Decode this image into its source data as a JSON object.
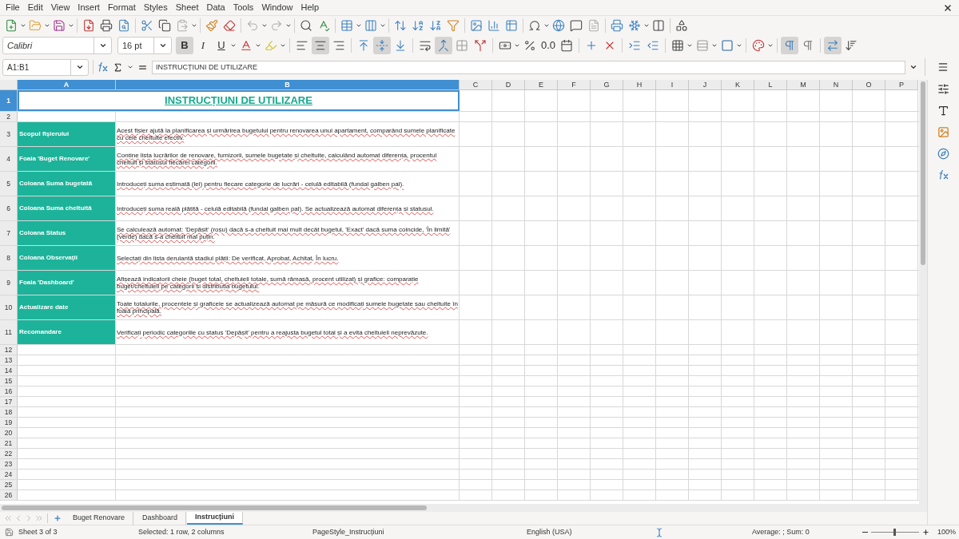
{
  "menu": [
    "File",
    "Edit",
    "View",
    "Insert",
    "Format",
    "Styles",
    "Sheet",
    "Data",
    "Tools",
    "Window",
    "Help"
  ],
  "standard_toolbar": [
    {
      "kind": "new",
      "dropdown": true,
      "disabled": false
    },
    {
      "kind": "open",
      "dropdown": true,
      "disabled": false
    },
    {
      "kind": "save",
      "dropdown": true,
      "disabled": false
    },
    {
      "kind": "sep"
    },
    {
      "kind": "pdf",
      "disabled": false
    },
    {
      "kind": "print",
      "disabled": false
    },
    {
      "kind": "preview",
      "disabled": false
    },
    {
      "kind": "sep"
    },
    {
      "kind": "cut",
      "disabled": false
    },
    {
      "kind": "copy",
      "disabled": false
    },
    {
      "kind": "paste",
      "dropdown": true,
      "disabled": true
    },
    {
      "kind": "sep"
    },
    {
      "kind": "clone",
      "disabled": false
    },
    {
      "kind": "clear",
      "disabled": false
    },
    {
      "kind": "sep"
    },
    {
      "kind": "undo",
      "dropdown": true,
      "disabled": true
    },
    {
      "kind": "redo",
      "dropdown": true,
      "disabled": true
    },
    {
      "kind": "sep"
    },
    {
      "kind": "find",
      "disabled": false
    },
    {
      "kind": "spelling",
      "disabled": false
    },
    {
      "kind": "sep"
    },
    {
      "kind": "rows",
      "dropdown": true,
      "disabled": false
    },
    {
      "kind": "columns",
      "dropdown": true,
      "disabled": false
    },
    {
      "kind": "sep"
    },
    {
      "kind": "sort",
      "disabled": false
    },
    {
      "kind": "sort-asc",
      "disabled": false
    },
    {
      "kind": "sort-desc",
      "disabled": false
    },
    {
      "kind": "filter",
      "disabled": false
    },
    {
      "kind": "sep"
    },
    {
      "kind": "image",
      "disabled": false
    },
    {
      "kind": "chart",
      "disabled": false
    },
    {
      "kind": "pivot",
      "disabled": false
    },
    {
      "kind": "sep"
    },
    {
      "kind": "special-char",
      "dropdown": true,
      "disabled": false
    },
    {
      "kind": "link",
      "disabled": false
    },
    {
      "kind": "comment",
      "disabled": false
    },
    {
      "kind": "header-footer",
      "disabled": true
    },
    {
      "kind": "sep"
    },
    {
      "kind": "print-range",
      "disabled": false
    },
    {
      "kind": "freeze",
      "dropdown": true,
      "disabled": false
    },
    {
      "kind": "split",
      "disabled": false
    },
    {
      "kind": "sep"
    },
    {
      "kind": "shapes",
      "disabled": false
    }
  ],
  "font_name": "Calibri",
  "font_size": "16 pt",
  "format_toolbar": [
    {
      "kind": "bold",
      "label": "B",
      "pressed": true
    },
    {
      "kind": "italic",
      "label": "I",
      "pressed": false
    },
    {
      "kind": "underline",
      "label": "U",
      "dropdown": true,
      "pressed": false
    },
    {
      "kind": "font-color",
      "dropdown": true,
      "pressed": false
    },
    {
      "kind": "highlight",
      "dropdown": true,
      "pressed": false
    },
    {
      "kind": "sep"
    },
    {
      "kind": "align-left",
      "pressed": false
    },
    {
      "kind": "align-center",
      "pressed": true
    },
    {
      "kind": "align-right",
      "pressed": false
    },
    {
      "kind": "sep"
    },
    {
      "kind": "align-top",
      "pressed": false
    },
    {
      "kind": "align-middle",
      "pressed": true
    },
    {
      "kind": "align-bottom",
      "pressed": false
    },
    {
      "kind": "sep"
    },
    {
      "kind": "wrap",
      "pressed": false
    },
    {
      "kind": "merge-center",
      "pressed": true
    },
    {
      "kind": "merge",
      "pressed": false
    },
    {
      "kind": "unmerge",
      "pressed": false
    },
    {
      "kind": "sep"
    },
    {
      "kind": "currency",
      "dropdown": true,
      "pressed": false
    },
    {
      "kind": "percent",
      "pressed": false
    },
    {
      "kind": "number",
      "label": "0.0",
      "pressed": false
    },
    {
      "kind": "date",
      "pressed": false
    },
    {
      "kind": "sep"
    },
    {
      "kind": "add-decimal",
      "pressed": false
    },
    {
      "kind": "delete-decimal",
      "pressed": false
    },
    {
      "kind": "sep"
    },
    {
      "kind": "indent",
      "pressed": false
    },
    {
      "kind": "outdent",
      "pressed": false
    },
    {
      "kind": "sep"
    },
    {
      "kind": "borders",
      "dropdown": true,
      "pressed": false
    },
    {
      "kind": "border-style",
      "dropdown": true,
      "pressed": false
    },
    {
      "kind": "border-color",
      "dropdown": true,
      "pressed": false
    },
    {
      "kind": "sep"
    },
    {
      "kind": "conditional",
      "dropdown": true,
      "pressed": false
    },
    {
      "kind": "sep"
    },
    {
      "kind": "ltr",
      "pressed": true
    },
    {
      "kind": "rtl",
      "pressed": false
    },
    {
      "kind": "sep"
    },
    {
      "kind": "text-horizontal",
      "pressed": true
    },
    {
      "kind": "text-vertical",
      "pressed": false
    }
  ],
  "name_box": "A1:B1",
  "formula": "INSTRUCȚIUNI DE UTILIZARE",
  "columns": [
    {
      "label": "A",
      "selected": true
    },
    {
      "label": "B",
      "selected": true
    },
    {
      "label": "C",
      "selected": false
    },
    {
      "label": "D",
      "selected": false
    },
    {
      "label": "E",
      "selected": false
    },
    {
      "label": "F",
      "selected": false
    },
    {
      "label": "G",
      "selected": false
    },
    {
      "label": "H",
      "selected": false
    },
    {
      "label": "I",
      "selected": false
    },
    {
      "label": "J",
      "selected": false
    },
    {
      "label": "K",
      "selected": false
    },
    {
      "label": "L",
      "selected": false
    },
    {
      "label": "M",
      "selected": false
    },
    {
      "label": "N",
      "selected": false
    },
    {
      "label": "O",
      "selected": false
    },
    {
      "label": "P",
      "selected": false
    }
  ],
  "rows": [
    {
      "number": "1",
      "kind": "title",
      "selected": true,
      "title": "INSTRUCȚIUNI DE UTILIZARE"
    },
    {
      "number": "2",
      "kind": "spacer",
      "selected": false
    },
    {
      "number": "3",
      "kind": "entry",
      "selected": false,
      "a": "Scopul fișierului",
      "b": "Acest fișier ajută la planificarea și urmărirea bugetului pentru renovarea unui apartament, comparând sumele planificate cu cele cheltuite efectiv."
    },
    {
      "number": "4",
      "kind": "entry",
      "selected": false,
      "a": "Foaia 'Buget Renovare'",
      "b": "Conține lista lucrărilor de renovare, furnizorii, sumele bugetate și cheltuite, calculând automat diferența, procentul cheltuit și statusul fiecărei categorii."
    },
    {
      "number": "5",
      "kind": "entry",
      "selected": false,
      "a": "Coloana Suma bugetată",
      "b": "Introduceți suma estimată (lei) pentru fiecare categorie de lucrări - celulă editabilă (fundal galben pal)."
    },
    {
      "number": "6",
      "kind": "entry",
      "selected": false,
      "a": "Coloana Suma cheltuită",
      "b": "Introduceți suma reală plătită - celulă editabilă (fundal galben pal). Se actualizează automat diferența și statusul."
    },
    {
      "number": "7",
      "kind": "entry",
      "selected": false,
      "a": "Coloana Status",
      "b": "Se calculează automat: 'Depășit' (roșu) dacă s-a cheltuit mai mult decât bugetul, 'Exact' dacă suma coincide, 'În limită' (verde) dacă s-a cheltuit mai puțin."
    },
    {
      "number": "8",
      "kind": "entry",
      "selected": false,
      "a": "Coloana Observații",
      "b": "Selectați din lista derulantă stadiul plății: De verificat, Aprobat, Achitat, În lucru."
    },
    {
      "number": "9",
      "kind": "entry",
      "selected": false,
      "a": "Foaia 'Dashboard'",
      "b": "Afișează indicatorii cheie (buget total, cheltuieli totale, sumă rămasă, procent utilizat) și grafice: comparație buget/cheltuieli pe categorii și distribuția bugetului."
    },
    {
      "number": "10",
      "kind": "entry",
      "selected": false,
      "a": "Actualizare date",
      "b": "Toate totalurile, procentele și graficele se actualizează automat pe măsură ce modificați sumele bugetate sau cheltuite în foaia principală."
    },
    {
      "number": "11",
      "kind": "entry",
      "selected": false,
      "a": "Recomandare",
      "b": "Verificați periodic categoriile cu status 'Depășit' pentru a reajusta bugetul total și a evita cheltuieli neprevăzute."
    },
    {
      "number": "12",
      "kind": "blank",
      "selected": false
    },
    {
      "number": "13",
      "kind": "blank",
      "selected": false
    },
    {
      "number": "14",
      "kind": "blank",
      "selected": false
    },
    {
      "number": "15",
      "kind": "blank",
      "selected": false
    },
    {
      "number": "16",
      "kind": "blank",
      "selected": false
    },
    {
      "number": "17",
      "kind": "blank",
      "selected": false
    },
    {
      "number": "18",
      "kind": "blank",
      "selected": false
    },
    {
      "number": "19",
      "kind": "blank",
      "selected": false
    },
    {
      "number": "20",
      "kind": "blank",
      "selected": false
    },
    {
      "number": "21",
      "kind": "blank",
      "selected": false
    },
    {
      "number": "22",
      "kind": "blank",
      "selected": false
    },
    {
      "number": "23",
      "kind": "blank",
      "selected": false
    },
    {
      "number": "24",
      "kind": "blank",
      "selected": false
    },
    {
      "number": "25",
      "kind": "blank",
      "selected": false
    },
    {
      "number": "26",
      "kind": "blank",
      "selected": false
    }
  ],
  "sheet_tabs": [
    {
      "label": "Buget Renovare",
      "selected": false
    },
    {
      "label": "Dashboard",
      "selected": false
    },
    {
      "label": "Instrucțiuni",
      "selected": true
    }
  ],
  "status_bar": {
    "sheet": "Sheet 3 of 3",
    "selection": "Selected: 1 row, 2 columns",
    "page_style": "PageStyle_Instrucțiuni",
    "language": "English (USA)",
    "summary": "Average: ; Sum: 0",
    "zoom": "100%",
    "zoom_slider": {
      "level": 0.5
    }
  }
}
